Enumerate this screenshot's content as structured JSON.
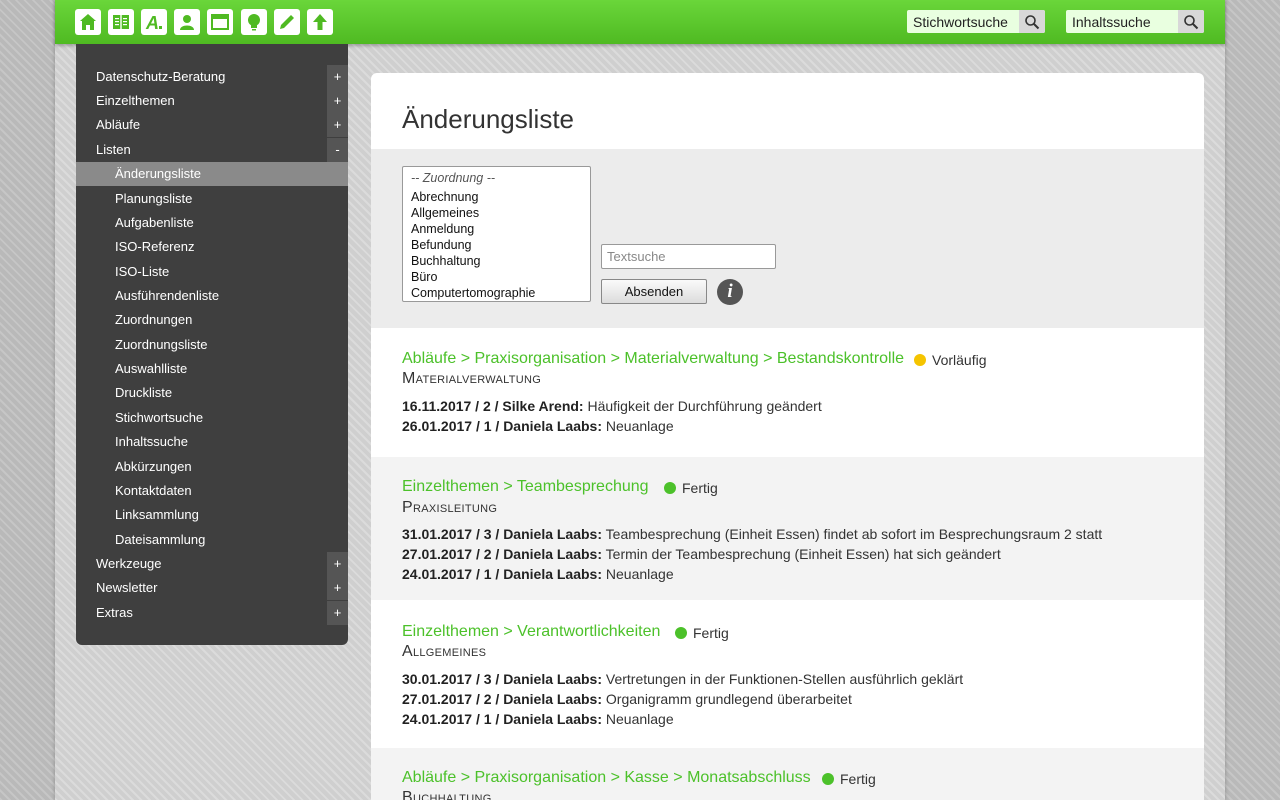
{
  "topbar": {
    "icons": [
      "home-icon",
      "book-icon",
      "letter-a-icon",
      "person-icon",
      "window-icon",
      "lightbulb-icon",
      "pencil-icon",
      "arrow-up-icon"
    ],
    "search_keyword_placeholder": "Stichwortsuche",
    "search_content_placeholder": "Inhaltssuche",
    "accent_color": "#5ac92e"
  },
  "sidebar": {
    "items": [
      {
        "label": "Datenschutz-Beratung",
        "toggle": "+"
      },
      {
        "label": "Einzelthemen",
        "toggle": "+"
      },
      {
        "label": "Abläufe",
        "toggle": "+"
      },
      {
        "label": "Listen",
        "toggle": "-"
      },
      {
        "label": "Änderungsliste"
      },
      {
        "label": "Planungsliste"
      },
      {
        "label": "Aufgabenliste"
      },
      {
        "label": "ISO-Referenz"
      },
      {
        "label": "ISO-Liste"
      },
      {
        "label": "Ausführendenliste"
      },
      {
        "label": "Zuordnungen"
      },
      {
        "label": "Zuordnungsliste"
      },
      {
        "label": "Auswahlliste"
      },
      {
        "label": "Druckliste"
      },
      {
        "label": "Stichwortsuche"
      },
      {
        "label": "Inhaltssuche"
      },
      {
        "label": "Abkürzungen"
      },
      {
        "label": "Kontaktdaten"
      },
      {
        "label": "Linksammlung"
      },
      {
        "label": "Dateisammlung"
      },
      {
        "label": "Werkzeuge",
        "toggle": "+"
      },
      {
        "label": "Newsletter",
        "toggle": "+"
      },
      {
        "label": "Extras",
        "toggle": "+"
      }
    ]
  },
  "main": {
    "title": "Änderungsliste",
    "filter": {
      "listbox_placeholder": "-- Zuordnung --",
      "options": [
        "Abrechnung",
        "Allgemeines",
        "Anmeldung",
        "Befundung",
        "Buchhaltung",
        "Büro",
        "Computertomographie"
      ],
      "text_placeholder": "Textsuche",
      "submit_label": "Absenden",
      "info_label": "i"
    },
    "entries": [
      {
        "crumb": "Abläufe > Praxisorganisation > Materialverwaltung > Bestandskontrolle",
        "status": "Vorläufig",
        "status_color": "#f5c400",
        "category": "Materialverwaltung",
        "lines": [
          {
            "meta": "16.11.2017 / 2 / Silke Arend:",
            "text": "Häufigkeit der Durchführung geändert"
          },
          {
            "meta": "26.01.2017 / 1 / Daniela Laabs:",
            "text": "Neuanlage"
          }
        ]
      },
      {
        "crumb": "Einzelthemen > Teambesprechung",
        "status": "Fertig",
        "status_color": "#4cc12a",
        "category": "Praxisleitung",
        "lines": [
          {
            "meta": "31.01.2017 / 3 / Daniela Laabs:",
            "text": "Teambesprechung (Einheit Essen) findet ab sofort im Besprechungsraum 2 statt"
          },
          {
            "meta": "27.01.2017 / 2 / Daniela Laabs:",
            "text": "Termin der Teambesprechung (Einheit Essen) hat sich geändert"
          },
          {
            "meta": "24.01.2017 / 1 / Daniela Laabs:",
            "text": "Neuanlage"
          }
        ]
      },
      {
        "crumb": "Einzelthemen > Verantwortlichkeiten",
        "status": "Fertig",
        "status_color": "#4cc12a",
        "category": "Allgemeines",
        "lines": [
          {
            "meta": "30.01.2017 / 3 / Daniela Laabs:",
            "text": "Vertretungen in der Funktionen-Stellen ausführlich geklärt"
          },
          {
            "meta": "27.01.2017 / 2 / Daniela Laabs:",
            "text": "Organigramm grundlegend überarbeitet"
          },
          {
            "meta": "24.01.2017 / 1 / Daniela Laabs:",
            "text": "Neuanlage"
          }
        ]
      },
      {
        "crumb": "Abläufe > Praxisorganisation > Kasse > Monatsabschluss",
        "status": "Fertig",
        "status_color": "#4cc12a",
        "category": "Buchhaltung",
        "lines": []
      }
    ]
  }
}
